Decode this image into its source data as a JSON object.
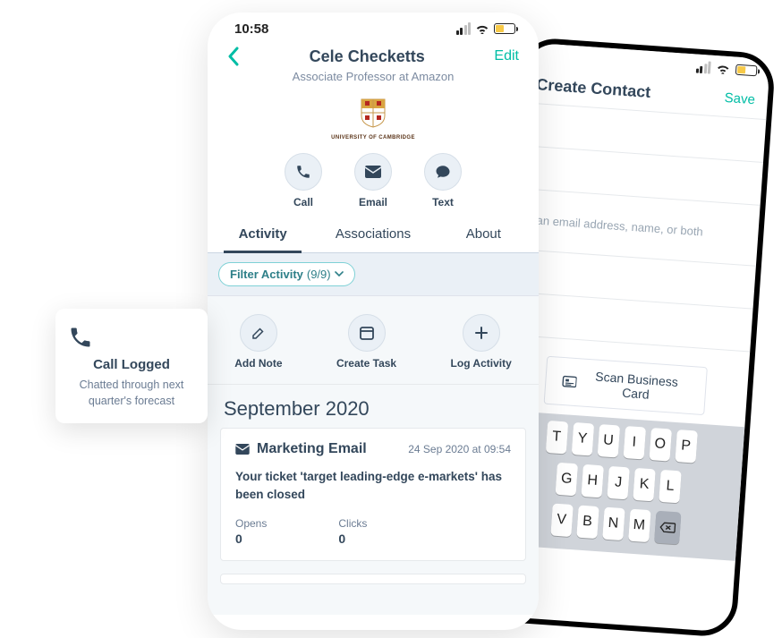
{
  "front": {
    "time": "10:58",
    "contact_name": "Cele Checketts",
    "subtitle": "Associate Professor at Amazon",
    "edit_label": "Edit",
    "logo_caption": "UNIVERSITY OF CAMBRIDGE",
    "comms": {
      "call": "Call",
      "email": "Email",
      "text": "Text"
    },
    "tabs": {
      "activity": "Activity",
      "associations": "Associations",
      "about": "About"
    },
    "filter": {
      "label": "Filter Activity",
      "count": "(9/9)"
    },
    "quick": {
      "add_note": "Add Note",
      "create_task": "Create Task",
      "log_activity": "Log Activity"
    },
    "month_header": "September 2020",
    "email_card": {
      "title": "Marketing Email",
      "timestamp": "24 Sep 2020 at 09:54",
      "body": "Your ticket 'target leading-edge e-markets' has been closed",
      "opens_label": "Opens",
      "opens_value": "0",
      "clicks_label": "Clicks",
      "clicks_value": "0"
    }
  },
  "toast": {
    "title": "Call Logged",
    "body": "Chatted through next quarter's forecast"
  },
  "rear": {
    "title": "Create Contact",
    "save_label": "Save",
    "hint": "g an email address, name, or both",
    "scan_label": "Scan Business Card",
    "keys_row1": [
      "T",
      "Y",
      "U",
      "I",
      "O",
      "P"
    ],
    "keys_row2": [
      "G",
      "H",
      "J",
      "K",
      "L"
    ],
    "keys_row3": [
      "V",
      "B",
      "N",
      "M"
    ]
  }
}
